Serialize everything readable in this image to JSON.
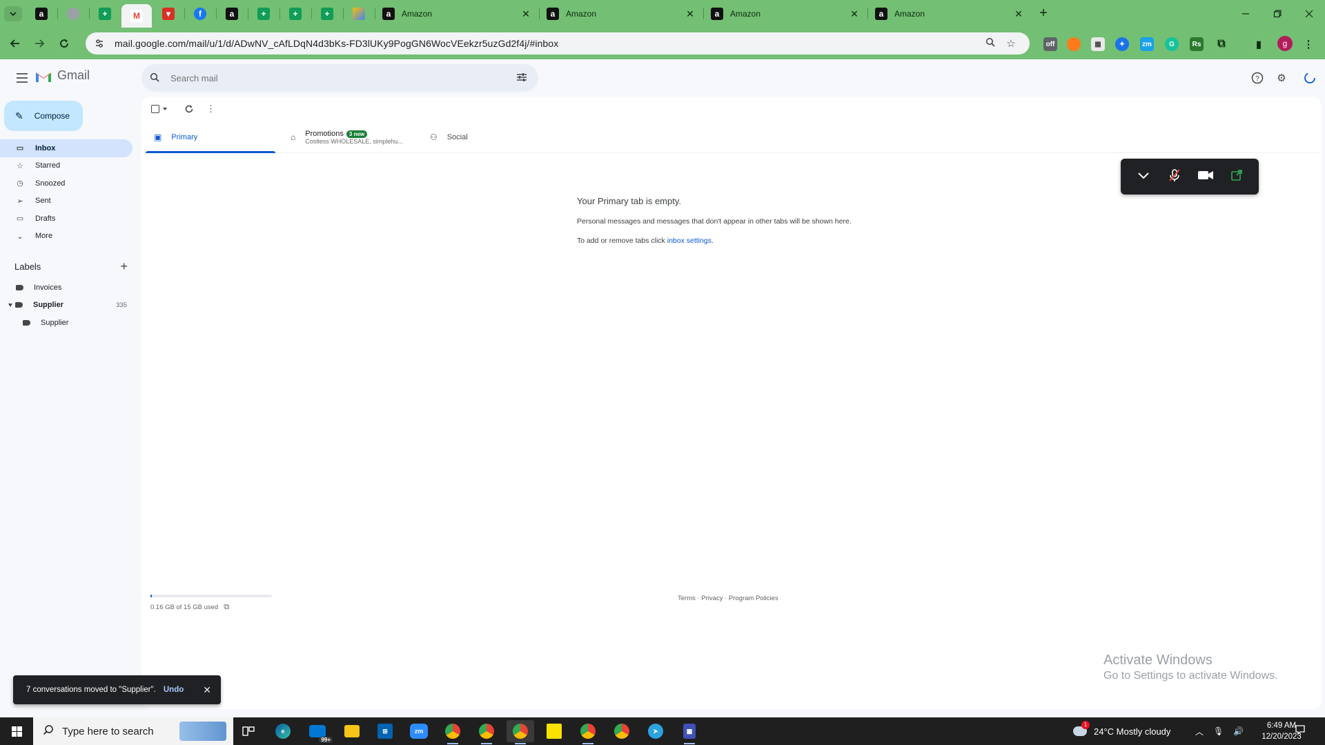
{
  "browser": {
    "pinned_tabs": [
      {
        "icon": "amazon-icon",
        "glyph": "a"
      },
      {
        "icon": "globe-icon",
        "glyph": ""
      },
      {
        "icon": "sheets-icon",
        "glyph": "+"
      },
      {
        "icon": "gmail-icon",
        "glyph": "M"
      },
      {
        "icon": "red-app-icon",
        "glyph": "▾"
      },
      {
        "icon": "facebook-icon",
        "glyph": "f"
      },
      {
        "icon": "amazon-icon",
        "glyph": "a"
      },
      {
        "icon": "sheets-icon",
        "glyph": "+"
      },
      {
        "icon": "sheets-icon",
        "glyph": "+"
      },
      {
        "icon": "sheets-icon",
        "glyph": "+"
      },
      {
        "icon": "colorful-app-icon",
        "glyph": ""
      }
    ],
    "tabs": [
      {
        "title": "Amazon"
      },
      {
        "title": "Amazon"
      },
      {
        "title": "Amazon"
      },
      {
        "title": "Amazon"
      }
    ],
    "new_tab_label": "+",
    "url": "mail.google.com/mail/u/1/d/ADwNV_cAfLDqN4d3bKs-FD3lUKy9PogGN6WocVEekzr5uzGd2f4j/#inbox",
    "profile_initial": "g",
    "accent_color": "#73bf74"
  },
  "gmail": {
    "app_name": "Gmail",
    "search_placeholder": "Search mail",
    "compose_label": "Compose",
    "nav": [
      {
        "label": "Inbox",
        "icon": "inbox-icon",
        "glyph": "▭"
      },
      {
        "label": "Starred",
        "icon": "star-icon",
        "glyph": "☆"
      },
      {
        "label": "Snoozed",
        "icon": "clock-icon",
        "glyph": "◷"
      },
      {
        "label": "Sent",
        "icon": "send-icon",
        "glyph": "➢"
      },
      {
        "label": "Drafts",
        "icon": "draft-icon",
        "glyph": "▭"
      },
      {
        "label": "More",
        "icon": "chevron-down-icon",
        "glyph": "⌄"
      }
    ],
    "labels_heading": "Labels",
    "labels": [
      {
        "name": "Invoices",
        "count": ""
      },
      {
        "name": "Supplier",
        "count": "335"
      },
      {
        "name": "Supplier",
        "count": ""
      }
    ],
    "inbox_tabs": {
      "primary": "Primary",
      "promotions": "Promotions",
      "promotions_badge": "3 new",
      "promotions_sub": "Costless WHOLESALE, simplehu...",
      "social": "Social"
    },
    "empty": {
      "title": "Your Primary tab is empty.",
      "line1": "Personal messages and messages that don't appear in other tabs will be shown here.",
      "line2_prefix": "To add or remove tabs click ",
      "line2_link": "inbox settings",
      "line2_suffix": "."
    },
    "storage": {
      "text": "0.16 GB of 15 GB used",
      "used_fraction": 0.011
    },
    "footer": "Terms · Privacy · Program Policies",
    "snackbar": {
      "message": "7 conversations moved to \"Supplier\".",
      "action": "Undo"
    }
  },
  "watermark": {
    "line1": "Activate Windows",
    "line2": "Go to Settings to activate Windows."
  },
  "taskbar": {
    "search_placeholder": "Type here to search",
    "weather": "24°C  Mostly cloudy",
    "time": "6:49 AM",
    "date": "12/20/2023",
    "mail_badge": "99+"
  }
}
